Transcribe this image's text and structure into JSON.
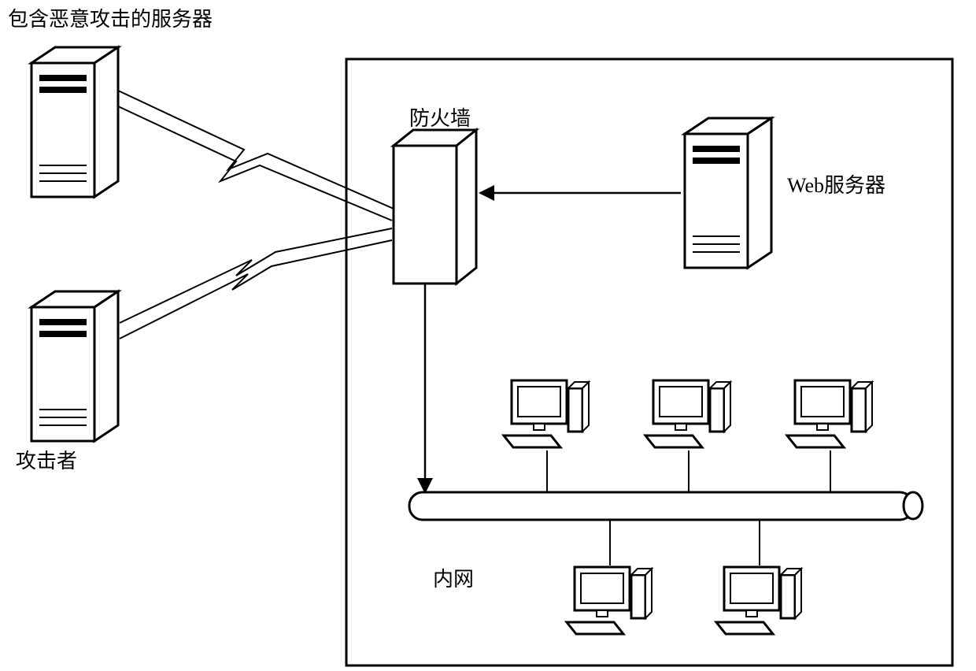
{
  "labels": {
    "title_malicious_server": "包含恶意攻击的服务器",
    "attacker": "攻击者",
    "firewall": "防火墙",
    "web_server": "Web服务器",
    "intranet": "内网"
  },
  "icons": {
    "server_malicious": "server-icon",
    "server_attacker": "server-icon",
    "server_web": "server-icon",
    "firewall": "firewall-icon",
    "pc": "computer-icon",
    "bus": "network-bus-icon"
  },
  "structure": {
    "external": [
      "malicious_server",
      "attacker"
    ],
    "internal": {
      "boundary": "zone-box",
      "firewall": "firewall",
      "web_server": "web_server",
      "pcs_top_row": 3,
      "pcs_bottom_row": 2,
      "bus": "network_bus"
    },
    "connections": [
      {
        "from": "malicious_server",
        "to": "firewall",
        "style": "blocked"
      },
      {
        "from": "attacker",
        "to": "firewall",
        "style": "blocked"
      },
      {
        "from": "web_server",
        "to": "firewall",
        "style": "arrow"
      },
      {
        "from": "firewall",
        "to": "network_bus",
        "style": "arrow"
      }
    ]
  }
}
